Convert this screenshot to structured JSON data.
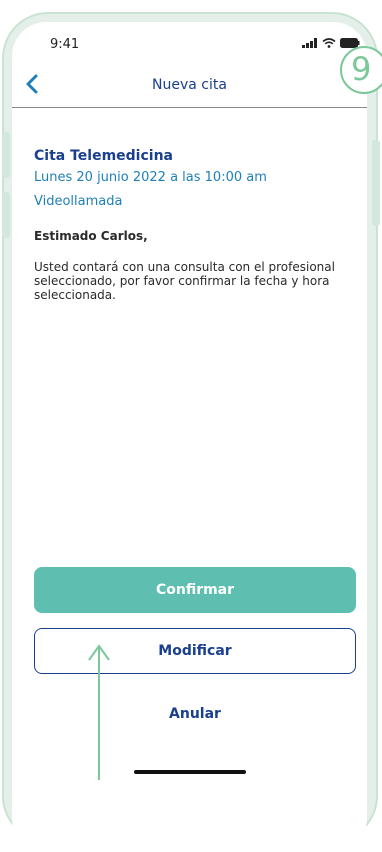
{
  "status_bar": {
    "time": "9:41"
  },
  "nav": {
    "title": "Nueva cita"
  },
  "step": {
    "number": "9"
  },
  "appointment": {
    "title": "Cita Telemedicina",
    "date": "Lunes 20 junio 2022 a las 10:00 am",
    "type": "Videollamada"
  },
  "body": {
    "greeting": "Estimado Carlos,",
    "message": "Usted contará con una consulta con el profesional seleccionado, por favor confirmar la fecha y hora seleccionada."
  },
  "buttons": {
    "confirm": "Confirmar",
    "modify": "Modificar",
    "cancel": "Anular"
  },
  "colors": {
    "primary": "#1a3f8f",
    "link": "#1f7fb8",
    "confirm_bg": "#5ebfb0",
    "frame": "#e3efe8",
    "annotation": "#7cc89a"
  }
}
